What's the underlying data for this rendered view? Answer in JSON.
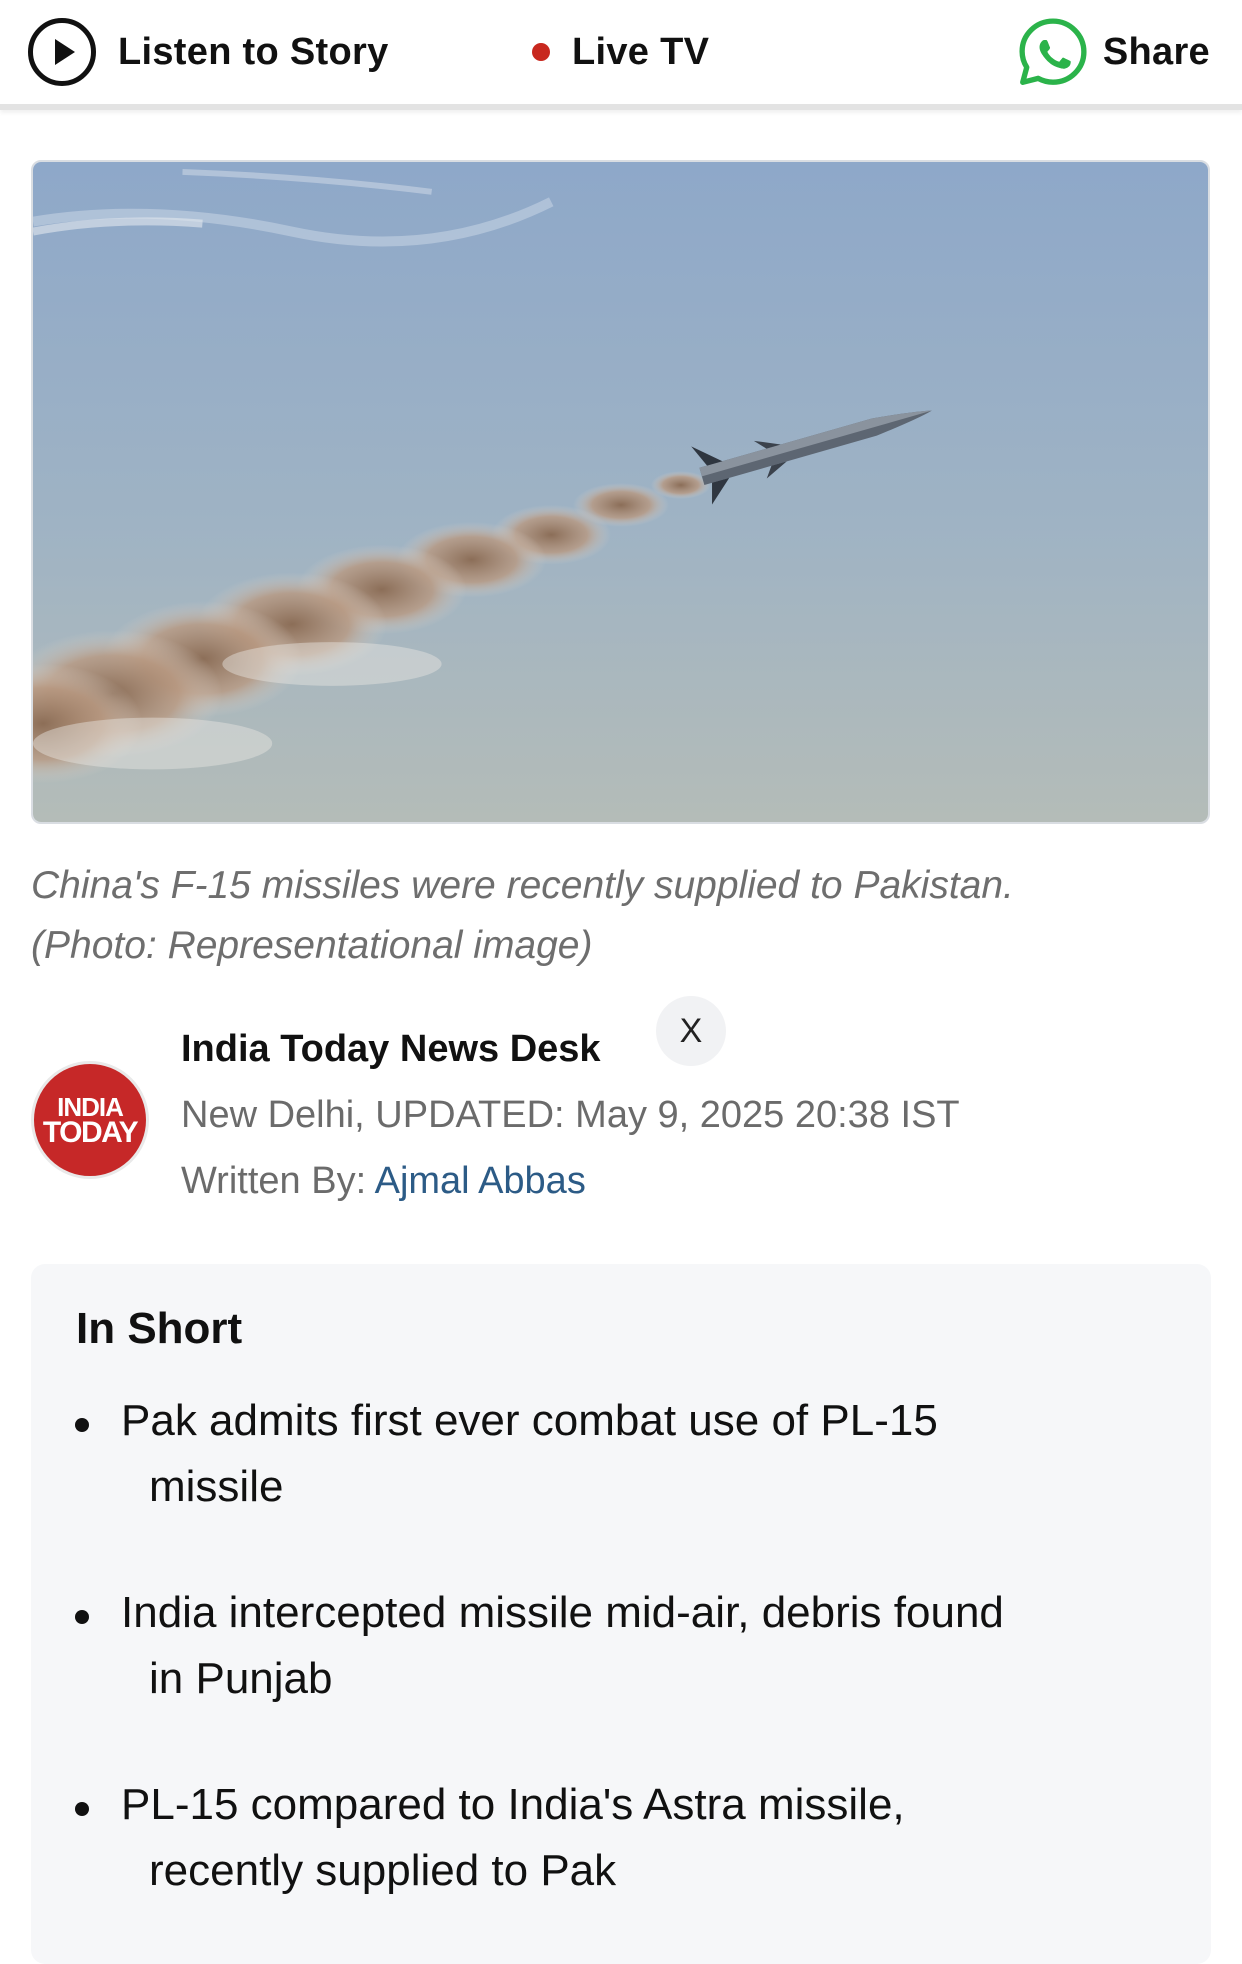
{
  "topbar": {
    "listen_label": "Listen to Story",
    "live_label": "Live TV",
    "share_label": "Share",
    "live_dot_color": "#c8281e",
    "share_icon": "whatsapp-icon",
    "whatsapp_color": "#2bb34a"
  },
  "hero": {
    "caption_line1": "China's F-15 missiles were recently supplied to Pakistan.",
    "caption_line2": "(Photo: Representational image)"
  },
  "author": {
    "logo_line1": "INDIA",
    "logo_line2": "TODAY",
    "name": "India Today News Desk",
    "social_icon": "X",
    "location": "New Delhi,",
    "updated": "UPDATED: May 9, 2025 20:38 IST",
    "written_prefix": "Written By:",
    "writer": "Ajmal Abbas"
  },
  "in_short": {
    "title": "In Short",
    "items": [
      {
        "line1": "Pak admits first ever combat use of PL-15",
        "line2": "missile"
      },
      {
        "line1": "India intercepted missile mid-air, debris found",
        "line2": "in Punjab"
      },
      {
        "line1": "PL-15 compared to India's Astra missile,",
        "line2": "recently supplied to Pak"
      }
    ]
  }
}
